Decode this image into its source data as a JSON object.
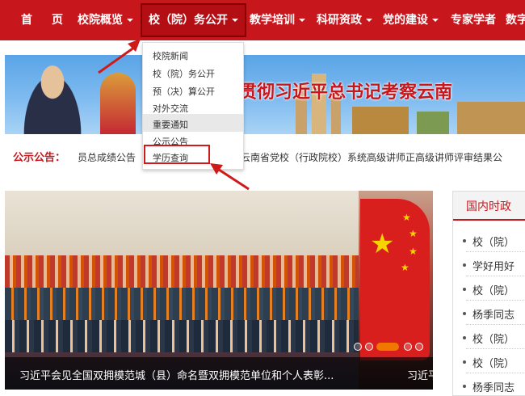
{
  "nav": {
    "items": [
      {
        "label": "首",
        "has_caret": false
      },
      {
        "label": "页",
        "has_caret": false
      },
      {
        "label": "校院概览",
        "has_caret": true
      },
      {
        "label": "校（院）务公开",
        "has_caret": true,
        "active": true
      },
      {
        "label": "教学培训",
        "has_caret": true
      },
      {
        "label": "科研资政",
        "has_caret": true
      },
      {
        "label": "党的建设",
        "has_caret": true
      },
      {
        "label": "专家学者",
        "has_caret": false
      },
      {
        "label": "数字",
        "has_caret": false
      }
    ]
  },
  "dropdown": {
    "items": [
      "校院新闻",
      "校（院）务公开",
      "预（决）算公开",
      "对外交流",
      "重要通知",
      "公示公告",
      "学历查询"
    ],
    "highlighted": "重要通知",
    "focused": "学历查询"
  },
  "banner": {
    "title": "贯彻习近平总书记考察云南"
  },
  "notice": {
    "label": "公示公告：",
    "text_left": "员总成绩公告",
    "text_right": "云南省党校（行政院校）系统高级讲师正高级讲师评审结果公"
  },
  "slider": {
    "caption": "习近平会见全国双拥模范城（县）命名暨双拥模范单位和个人表彰...",
    "caption_next": "习近平"
  },
  "panel": {
    "title": "国内时政",
    "items": [
      "校（院）",
      "学好用好",
      "校（院）",
      "杨季同志",
      "校（院）",
      "校（院）",
      "杨季同志"
    ]
  },
  "colors": {
    "brand_red": "#c8161d",
    "accent_orange": "#f07800"
  }
}
